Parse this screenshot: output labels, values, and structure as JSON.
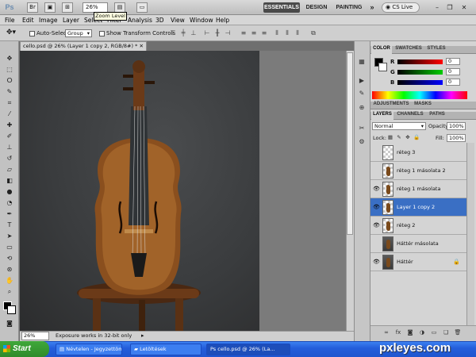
{
  "app": {
    "logo": "Ps",
    "zoom_value": "26%",
    "zoom_tooltip": "Zoom Level"
  },
  "workspaces": {
    "essentials": "ESSENTIALS",
    "design": "DESIGN",
    "painting": "PAINTING",
    "more": "»",
    "cs_live": "CS Live"
  },
  "menu": [
    "File",
    "Edit",
    "Image",
    "Layer",
    "Select",
    "Filter",
    "Analysis",
    "3D",
    "View",
    "Window",
    "Help"
  ],
  "options": {
    "auto_select_label": "Auto-Select:",
    "auto_select_value": "Group",
    "show_transform_label": "Show Transform Controls"
  },
  "document": {
    "tab_title": "cello.psd @ 26% (Layer 1 copy 2, RGB/8#) *",
    "status_zoom": "26%",
    "status_message": "Exposure works in 32-bit only"
  },
  "color_panel": {
    "tabs": [
      "COLOR",
      "SWATCHES",
      "STYLES"
    ],
    "r": "0",
    "g": "0",
    "b": "0",
    "r_label": "R",
    "g_label": "G",
    "b_label": "B"
  },
  "adjust_tabs": [
    "ADJUSTMENTS",
    "MASKS"
  ],
  "layers_panel": {
    "tabs": [
      "LAYERS",
      "CHANNELS",
      "PATHS"
    ],
    "blend_mode": "Normal",
    "opacity_label": "Opacity:",
    "opacity": "100%",
    "lock_label": "Lock:",
    "fill_label": "Fill:",
    "fill": "100%",
    "layers": [
      {
        "name": "réteg 3",
        "visible": false,
        "selected": false
      },
      {
        "name": "réteg 1 másolata 2",
        "visible": false,
        "selected": false
      },
      {
        "name": "réteg 1 másolata",
        "visible": true,
        "selected": false
      },
      {
        "name": "Layer 1 copy 2",
        "visible": true,
        "selected": true
      },
      {
        "name": "réteg 2",
        "visible": true,
        "selected": false
      },
      {
        "name": "Háttér másolata",
        "visible": false,
        "selected": false
      },
      {
        "name": "Háttér",
        "visible": true,
        "selected": false
      }
    ]
  },
  "taskbar": {
    "start": "Start",
    "tasks": [
      "Névtelen - Jegyzettömb",
      "Letöltések",
      "cello.psd @ 26% (La..."
    ]
  },
  "watermark": "pxleyes.com",
  "colors": {
    "selected_layer": "#3a6fc4",
    "taskbar": "#245edb",
    "start": "#2e8b2b"
  }
}
